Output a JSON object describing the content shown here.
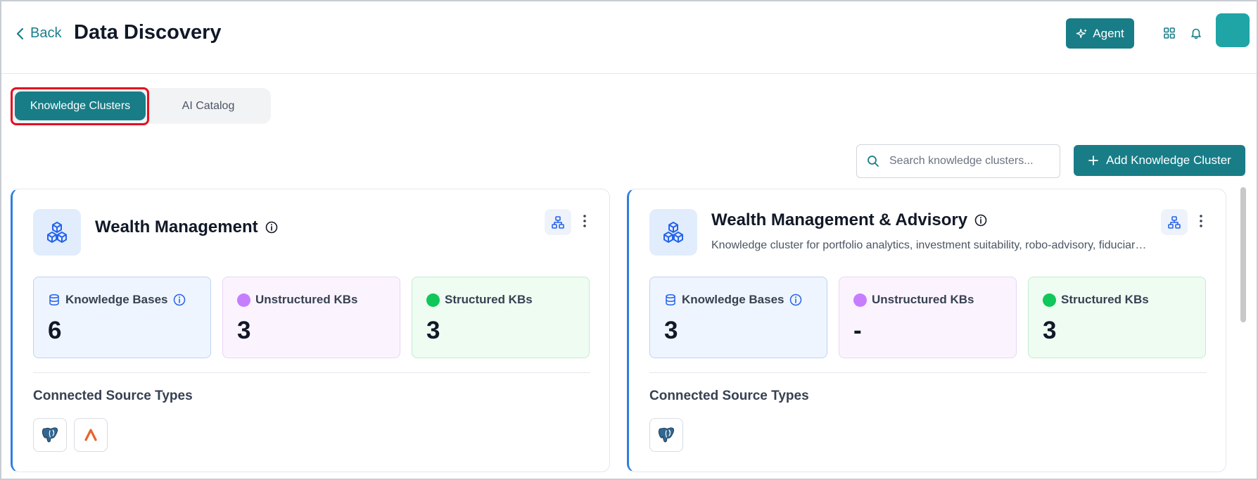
{
  "header": {
    "back_label": "Back",
    "title": "Data Discovery",
    "agent_label": "Agent",
    "icons": [
      "back-chevron-icon",
      "sparkles-icon",
      "apps-grid-icon",
      "bell-icon"
    ]
  },
  "tabs": [
    {
      "label": "Knowledge Clusters",
      "active": true
    },
    {
      "label": "AI Catalog",
      "active": false
    }
  ],
  "toolbar": {
    "search_placeholder": "Search knowledge clusters...",
    "add_label": "Add Knowledge Cluster"
  },
  "cards": [
    {
      "title": "Wealth Management",
      "description": "",
      "stats": {
        "knowledge_bases": {
          "label": "Knowledge Bases",
          "value": "6"
        },
        "unstructured": {
          "label": "Unstructured KBs",
          "value": "3"
        },
        "structured": {
          "label": "Structured KBs",
          "value": "3"
        }
      },
      "sources_title": "Connected Source Types",
      "sources": [
        "postgresql-icon",
        "delta-lake-icon"
      ]
    },
    {
      "title": "Wealth Management & Advisory",
      "description": "Knowledge cluster for portfolio analytics, investment suitability, robo-advisory, fiduciary compliance and client reporting",
      "stats": {
        "knowledge_bases": {
          "label": "Knowledge Bases",
          "value": "3"
        },
        "unstructured": {
          "label": "Unstructured KBs",
          "value": "-"
        },
        "structured": {
          "label": "Structured KBs",
          "value": "3"
        }
      },
      "sources_title": "Connected Source Types",
      "sources": [
        "postgresql-icon"
      ]
    }
  ],
  "colors": {
    "accent": "#187d87",
    "card_border": "#2f7de1",
    "highlight": "#e3101f",
    "unstructured_dot": "#c77dff",
    "structured_dot": "#10c75a",
    "avatar": "#1fa5a6"
  }
}
